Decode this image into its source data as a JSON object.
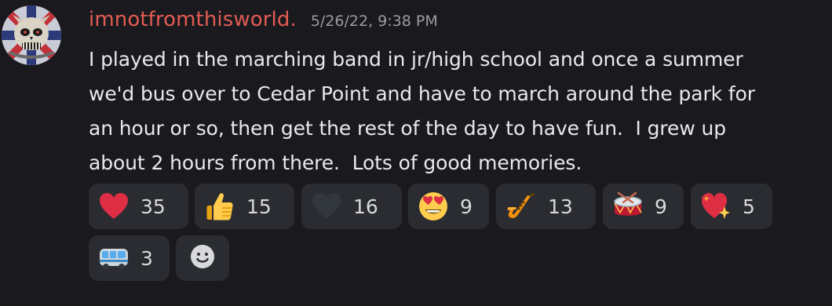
{
  "message": {
    "author": "imnotfromthisworld.",
    "timestamp": "5/26/22, 9:38 PM",
    "text": "I played in the marching band in jr/high school and once a summer\nwe'd bus over to Cedar Point and have to march around the park for\nan hour or so, then get the rest of the day to have fun.  I grew up\nabout 2 hours from there.  Lots of good memories.",
    "avatar_icon": "skull-emblem-avatar"
  },
  "reactions": [
    {
      "emoji": "red-heart-icon",
      "count": "35"
    },
    {
      "emoji": "thumbs-up-icon",
      "count": "15"
    },
    {
      "emoji": "black-heart-icon",
      "count": "16"
    },
    {
      "emoji": "heart-eyes-face-icon",
      "count": "9"
    },
    {
      "emoji": "saxophone-icon",
      "count": "13"
    },
    {
      "emoji": "drum-icon",
      "count": "9"
    },
    {
      "emoji": "sparkling-heart-icon",
      "count": "5"
    },
    {
      "emoji": "bus-icon",
      "count": "3"
    }
  ],
  "add_reaction": {
    "icon": "smiley-add-reaction-icon"
  },
  "colors": {
    "background": "#1a1a1e",
    "username": "#e25b53",
    "reaction_pill": "#2b2c31",
    "timestamp": "#9a9ca3"
  }
}
